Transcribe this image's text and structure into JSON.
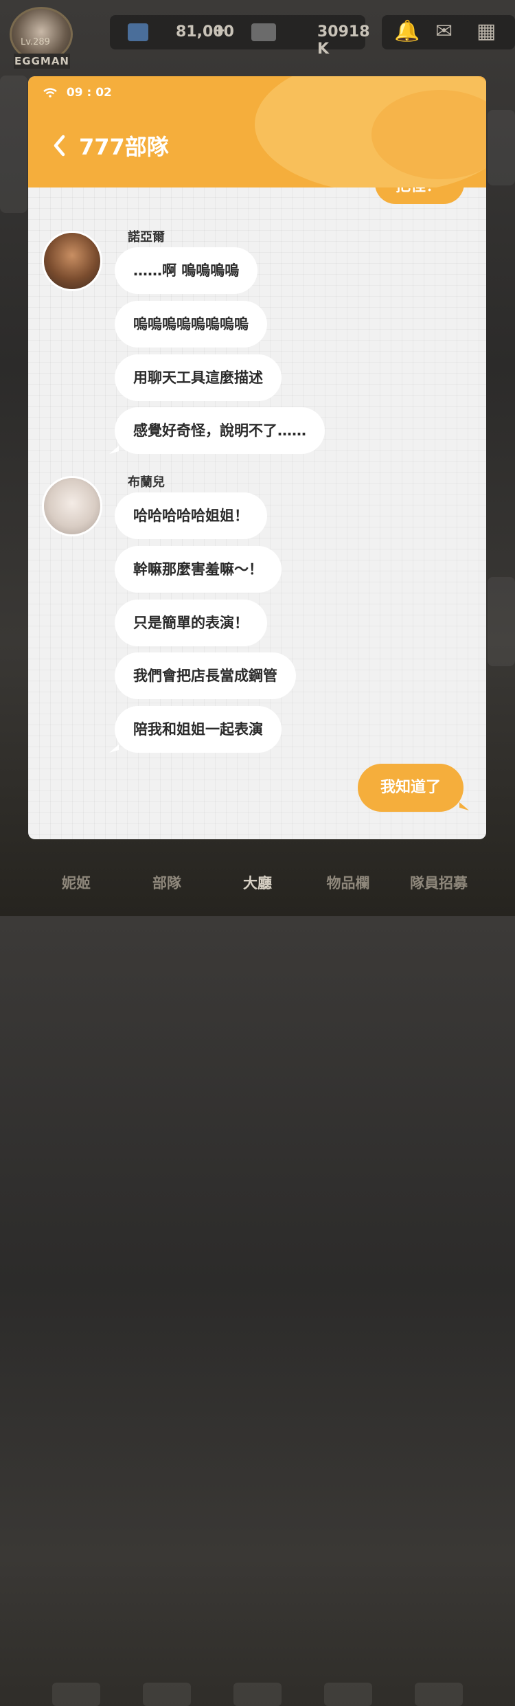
{
  "player": {
    "level": "Lv.289",
    "name": "EGGMAN"
  },
  "resources": {
    "gems": "81,000",
    "gems_add": "+",
    "credits": "30918 K"
  },
  "bottom_nav": [
    {
      "label": "妮姬"
    },
    {
      "label": "部隊"
    },
    {
      "label": "大廳"
    },
    {
      "label": "物品欄"
    },
    {
      "label": "隊員招募"
    }
  ],
  "chat": {
    "status_time": "09 : 02",
    "title": "777部隊",
    "partial_text": "把怪！",
    "groups": [
      {
        "sender": "諾亞爾",
        "messages": [
          "……啊 嗚嗚嗚嗚",
          "嗚嗚嗚嗚嗚嗚嗚嗚",
          "用聊天工具這麼描述",
          "感覺好奇怪，說明不了……"
        ]
      },
      {
        "sender": "布蘭兒",
        "messages": [
          "哈哈哈哈哈姐姐！",
          "幹嘛那麼害羞嘛～！",
          "只是簡單的表演！",
          "我們會把店長當成鋼管",
          "陪我和姐姐一起表演"
        ]
      }
    ],
    "reply": "我知道了"
  },
  "colors": {
    "accent": "#f5ae3c",
    "chat_bg": "#f1f1f1"
  }
}
